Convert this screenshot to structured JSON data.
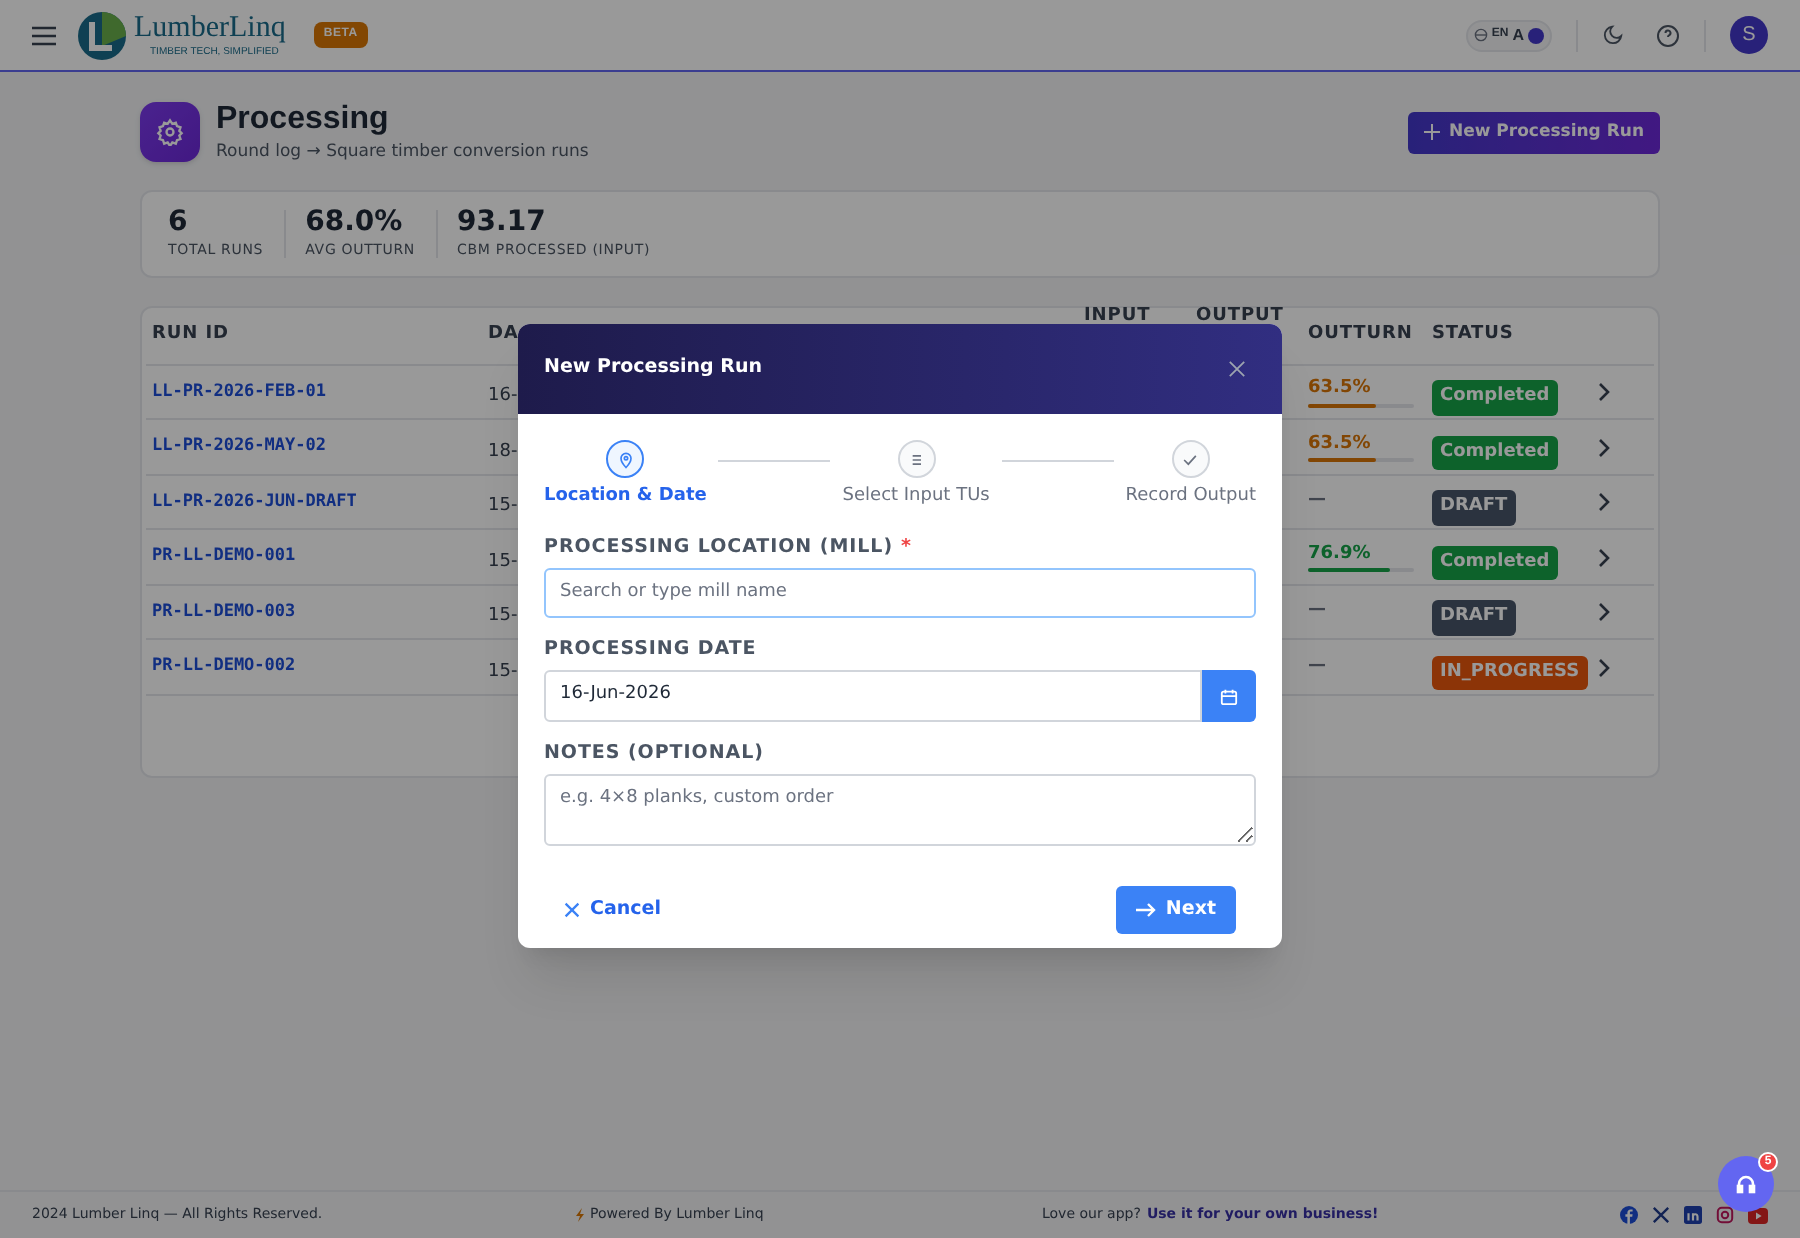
{
  "nav": {
    "logo_title": "LumberLinq",
    "logo_tagline": "TIMBER TECH, SIMPLIFIED",
    "badge": "BETA",
    "language": "EN",
    "font_toggle": "A",
    "avatar": "S"
  },
  "page": {
    "title": "Processing",
    "subtitle": "Round log → Square timber conversion runs",
    "new_button": "New Processing Run"
  },
  "stats": [
    {
      "value": "6",
      "label": "TOTAL RUNS"
    },
    {
      "value": "68.0%",
      "label": "AVG OUTTURN"
    },
    {
      "value": "93.17",
      "label": "CBM PROCESSED (INPUT)"
    }
  ],
  "table": {
    "columns": [
      "RUN ID",
      "DA",
      "INPUT",
      "OUTPUT",
      "OUTTURN",
      "STATUS"
    ],
    "rows": [
      {
        "run_id": "LL-PR-2026-FEB-01",
        "date": "16-",
        "outturn": {
          "text": "63.5%",
          "level": 0.635,
          "color": "#824704"
        },
        "status": {
          "label": "Completed",
          "color": "#0d622c"
        }
      },
      {
        "run_id": "LL-PR-2026-MAY-02",
        "date": "18-",
        "outturn": {
          "text": "63.5%",
          "level": 0.635,
          "color": "#824704"
        },
        "status": {
          "label": "Completed",
          "color": "#0d622c"
        }
      },
      {
        "run_id": "LL-PR-2026-JUN-DRAFT",
        "date": "15-",
        "outturn": {
          "text": "—"
        },
        "status": {
          "label": "DRAFT",
          "color": "#2b333f"
        }
      },
      {
        "run_id": "PR-LL-DEMO-001",
        "date": "15-",
        "outturn": {
          "text": "76.9%",
          "level": 0.769,
          "color": "#0d622c"
        },
        "status": {
          "label": "Completed",
          "color": "#0d622c"
        }
      },
      {
        "run_id": "PR-LL-DEMO-003",
        "date": "15-",
        "outturn": {
          "text": "—"
        },
        "status": {
          "label": "DRAFT",
          "color": "#2b333f"
        }
      },
      {
        "run_id": "PR-LL-DEMO-002",
        "date": "15-",
        "outturn": {
          "text": "—"
        },
        "status": {
          "label": "IN_PROGRESS",
          "color": "#8c3507"
        }
      }
    ]
  },
  "modal": {
    "title": "New Processing Run",
    "steps": [
      {
        "label": "Location & Date",
        "kind": "pin",
        "selected": true
      },
      {
        "label": "Select Input TUs",
        "kind": "list",
        "selected": false
      },
      {
        "label": "Record Output",
        "kind": "check",
        "selected": false
      }
    ],
    "location": {
      "label": "PROCESSING LOCATION (MILL)",
      "required_mark": "*",
      "placeholder": "Search or type mill name"
    },
    "date": {
      "label": "PROCESSING DATE",
      "value": "16-Jun-2026"
    },
    "notes": {
      "label": "NOTES (OPTIONAL)",
      "placeholder": "e.g. 4×8 planks, custom order"
    },
    "cancel": "Cancel",
    "next": "Next"
  },
  "footer": {
    "copyright": "2024 Lumber Linq — All Rights Reserved.",
    "powered": "Powered By Lumber Linq",
    "prompt": "Love our app?",
    "link": "Use it for your own business!"
  },
  "support": {
    "badge": "5"
  }
}
